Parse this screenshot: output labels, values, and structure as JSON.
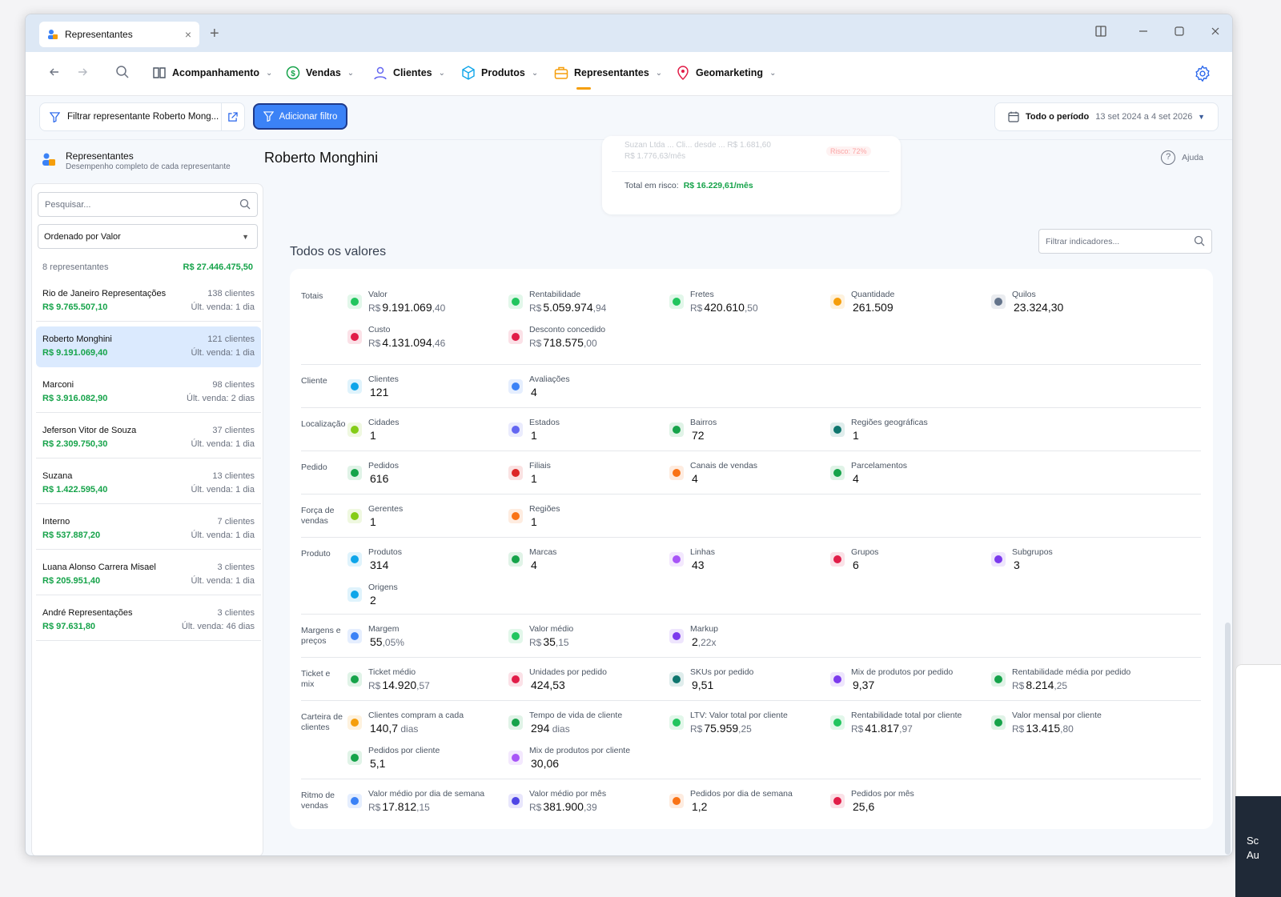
{
  "tab": {
    "title": "Representantes",
    "close": "×",
    "new": "+"
  },
  "nav": [
    {
      "label": "Acompanhamento",
      "icon": "book-icon"
    },
    {
      "label": "Vendas",
      "icon": "dollar-icon"
    },
    {
      "label": "Clientes",
      "icon": "user-icon"
    },
    {
      "label": "Produtos",
      "icon": "box-icon"
    },
    {
      "label": "Representantes",
      "icon": "briefcase-icon",
      "active": true
    },
    {
      "label": "Geomarketing",
      "icon": "pin-icon"
    }
  ],
  "filters": {
    "active_filter": "Filtrar representante Roberto Mong...",
    "add_filter": "Adicionar filtro",
    "period_label": "Todo o período",
    "period_range": "13 set 2024 a 4 set 2026"
  },
  "sidebar": {
    "title": "Representantes",
    "subtitle": "Desempenho completo de cada representante",
    "search_placeholder": "Pesquisar...",
    "sort": "Ordenado por Valor",
    "count": "8 representantes",
    "total": "R$ 27.446.475,50",
    "items": [
      {
        "name": "Rio de Janeiro Representações",
        "value": "R$ 9.765.507,10",
        "clients": "138 clientes",
        "last": "Últ. venda: 1 dia"
      },
      {
        "name": "Roberto Monghini",
        "value": "R$ 9.191.069,40",
        "clients": "121 clientes",
        "last": "Últ. venda: 1 dia",
        "selected": true
      },
      {
        "name": "Marconi",
        "value": "R$ 3.916.082,90",
        "clients": "98 clientes",
        "last": "Últ. venda: 2 dias"
      },
      {
        "name": "Jeferson Vitor de Souza",
        "value": "R$ 2.309.750,30",
        "clients": "37 clientes",
        "last": "Últ. venda: 1 dia"
      },
      {
        "name": "Suzana",
        "value": "R$ 1.422.595,40",
        "clients": "13 clientes",
        "last": "Últ. venda: 1 dia"
      },
      {
        "name": "Interno",
        "value": "R$ 537.887,20",
        "clients": "7 clientes",
        "last": "Últ. venda: 1 dia"
      },
      {
        "name": "Luana Alonso Carrera Misael",
        "value": "R$ 205.951,40",
        "clients": "3 clientes",
        "last": "Últ. venda: 1 dia"
      },
      {
        "name": "André Representações",
        "value": "R$ 97.631,80",
        "clients": "3 clientes",
        "last": "Últ. venda: 46 dias"
      }
    ]
  },
  "main": {
    "title": "Roberto Monghini",
    "help": "Ajuda",
    "risk_faded_1": "Suzan Ltda ... Cli... desde ... R$ 1.681,60",
    "risk_faded_2": "R$ 1.776,63/mês",
    "risk_tag": "Risco: 72%",
    "risk_label": "Total em risco:",
    "risk_value": "R$ 16.229,61/mês",
    "section_title": "Todos os valores",
    "indicator_filter_placeholder": "Filtrar indicadores..."
  },
  "metrics": [
    {
      "label": "Totais",
      "items": [
        {
          "l": "Valor",
          "p": "R$",
          "v": "9.191.069",
          "d": ",40",
          "icon": "dollar-icon",
          "color": "#22c55e"
        },
        {
          "l": "Rentabilidade",
          "p": "R$",
          "v": "5.059.974",
          "d": ",94",
          "icon": "money-bag-icon",
          "color": "#22c55e"
        },
        {
          "l": "Fretes",
          "p": "R$",
          "v": "420.610",
          "d": ",50",
          "icon": "truck-icon",
          "color": "#22c55e"
        },
        {
          "l": "Quantidade",
          "p": "",
          "v": "261.509",
          "d": "",
          "icon": "hash-icon",
          "color": "#f59e0b"
        },
        {
          "l": "Quilos",
          "p": "",
          "v": "23.324,30",
          "d": "",
          "icon": "scale-icon",
          "color": "#64748b"
        },
        {
          "l": "Custo",
          "p": "R$",
          "v": "4.131.094",
          "d": ",46",
          "icon": "wallet-icon",
          "color": "#e11d48"
        },
        {
          "l": "Desconto concedido",
          "p": "R$",
          "v": "718.575",
          "d": ",00",
          "icon": "tag-icon",
          "color": "#e11d48"
        }
      ]
    },
    {
      "label": "Cliente",
      "items": [
        {
          "l": "Clientes",
          "p": "",
          "v": "121",
          "d": "",
          "icon": "user-icon",
          "color": "#0ea5e9"
        },
        {
          "l": "Avaliações",
          "p": "",
          "v": "4",
          "d": "",
          "icon": "thumbs-up-icon",
          "color": "#3b82f6"
        }
      ]
    },
    {
      "label": "Localização",
      "items": [
        {
          "l": "Cidades",
          "p": "",
          "v": "1",
          "d": "",
          "icon": "building-icon",
          "color": "#84cc16"
        },
        {
          "l": "Estados",
          "p": "",
          "v": "1",
          "d": "",
          "icon": "uf-icon",
          "color": "#6366f1"
        },
        {
          "l": "Bairros",
          "p": "",
          "v": "72",
          "d": "",
          "icon": "home-icon",
          "color": "#16a34a"
        },
        {
          "l": "Regiões geográficas",
          "p": "",
          "v": "1",
          "d": "",
          "icon": "map-icon",
          "color": "#0f766e"
        }
      ]
    },
    {
      "label": "Pedido",
      "items": [
        {
          "l": "Pedidos",
          "p": "",
          "v": "616",
          "d": "",
          "icon": "cart-icon",
          "color": "#16a34a"
        },
        {
          "l": "Filiais",
          "p": "",
          "v": "1",
          "d": "",
          "icon": "factory-icon",
          "color": "#dc2626"
        },
        {
          "l": "Canais de vendas",
          "p": "",
          "v": "4",
          "d": "",
          "icon": "share-icon",
          "color": "#f97316"
        },
        {
          "l": "Parcelamentos",
          "p": "",
          "v": "4",
          "d": "",
          "icon": "cart-icon",
          "color": "#16a34a"
        }
      ]
    },
    {
      "label": "Força de vendas",
      "items": [
        {
          "l": "Gerentes",
          "p": "",
          "v": "1",
          "d": "",
          "icon": "crown-icon",
          "color": "#84cc16"
        },
        {
          "l": "Regiões",
          "p": "",
          "v": "1",
          "d": "",
          "icon": "pin-icon",
          "color": "#f97316"
        }
      ]
    },
    {
      "label": "Produto",
      "items": [
        {
          "l": "Produtos",
          "p": "",
          "v": "314",
          "d": "",
          "icon": "archive-icon",
          "color": "#0ea5e9"
        },
        {
          "l": "Marcas",
          "p": "",
          "v": "4",
          "d": "",
          "icon": "tag-icon",
          "color": "#16a34a"
        },
        {
          "l": "Linhas",
          "p": "",
          "v": "43",
          "d": "",
          "icon": "shapes-icon",
          "color": "#a855f7"
        },
        {
          "l": "Grupos",
          "p": "",
          "v": "6",
          "d": "",
          "icon": "layers-icon",
          "color": "#e11d48"
        },
        {
          "l": "Subgrupos",
          "p": "",
          "v": "3",
          "d": "",
          "icon": "layers-icon",
          "color": "#7c3aed"
        },
        {
          "l": "Origens",
          "p": "",
          "v": "2",
          "d": "",
          "icon": "globe-icon",
          "color": "#0ea5e9"
        }
      ]
    },
    {
      "label": "Margens e preços",
      "items": [
        {
          "l": "Margem",
          "p": "",
          "v": "55",
          "d": ",05%",
          "icon": "percent-icon",
          "color": "#3b82f6"
        },
        {
          "l": "Valor médio",
          "p": "R$",
          "v": "35",
          "d": ",15",
          "icon": "coin-icon",
          "color": "#22c55e"
        },
        {
          "l": "Markup",
          "p": "",
          "v": "2",
          "d": ",22x",
          "icon": "chart-icon",
          "color": "#7c3aed"
        }
      ]
    },
    {
      "label": "Ticket e mix",
      "items": [
        {
          "l": "Ticket médio",
          "p": "R$",
          "v": "14.920",
          "d": ",57",
          "icon": "receipt-icon",
          "color": "#16a34a"
        },
        {
          "l": "Unidades por pedido",
          "p": "",
          "v": "424,53",
          "d": "",
          "icon": "box-icon",
          "color": "#e11d48"
        },
        {
          "l": "SKUs por pedido",
          "p": "",
          "v": "9,51",
          "d": "",
          "icon": "bag-icon",
          "color": "#0f766e"
        },
        {
          "l": "Mix de produtos por pedido",
          "p": "",
          "v": "9,37",
          "d": "",
          "icon": "grid-icon",
          "color": "#7c3aed"
        },
        {
          "l": "Rentabilidade média por pedido",
          "p": "R$",
          "v": "8.214",
          "d": ",25",
          "icon": "money-bag-icon",
          "color": "#16a34a"
        }
      ]
    },
    {
      "label": "Carteira de clientes",
      "items": [
        {
          "l": "Clientes compram a cada",
          "p": "",
          "v": "140,7",
          "d": " dias",
          "icon": "users-clock-icon",
          "color": "#f59e0b"
        },
        {
          "l": "Tempo de vida de cliente",
          "p": "",
          "v": "294",
          "d": " dias",
          "icon": "hourglass-icon",
          "color": "#16a34a"
        },
        {
          "l": "LTV: Valor total por cliente",
          "p": "R$",
          "v": "75.959",
          "d": ",25",
          "icon": "diamond-icon",
          "color": "#22c55e"
        },
        {
          "l": "Rentabilidade total por cliente",
          "p": "R$",
          "v": "41.817",
          "d": ",97",
          "icon": "cycle-icon",
          "color": "#22c55e"
        },
        {
          "l": "Valor mensal por cliente",
          "p": "R$",
          "v": "13.415",
          "d": ",80",
          "icon": "card-icon",
          "color": "#16a34a"
        },
        {
          "l": "Pedidos por cliente",
          "p": "",
          "v": "5,1",
          "d": "",
          "icon": "user-cart-icon",
          "color": "#16a34a"
        },
        {
          "l": "Mix de produtos por cliente",
          "p": "",
          "v": "30,06",
          "d": "",
          "icon": "grid-icon",
          "color": "#a855f7"
        }
      ]
    },
    {
      "label": "Ritmo de vendas",
      "items": [
        {
          "l": "Valor médio por dia de semana",
          "p": "R$",
          "v": "17.812",
          "d": ",15",
          "icon": "calendar-icon",
          "color": "#3b82f6"
        },
        {
          "l": "Valor médio por mês",
          "p": "R$",
          "v": "381.900",
          "d": ",39",
          "icon": "calendar-icon",
          "color": "#4f46e5"
        },
        {
          "l": "Pedidos por dia de semana",
          "p": "",
          "v": "1,2",
          "d": "",
          "icon": "cart-circle-icon",
          "color": "#f97316"
        },
        {
          "l": "Pedidos por mês",
          "p": "",
          "v": "25,6",
          "d": "",
          "icon": "cart-circle-icon",
          "color": "#e11d48"
        }
      ]
    }
  ]
}
